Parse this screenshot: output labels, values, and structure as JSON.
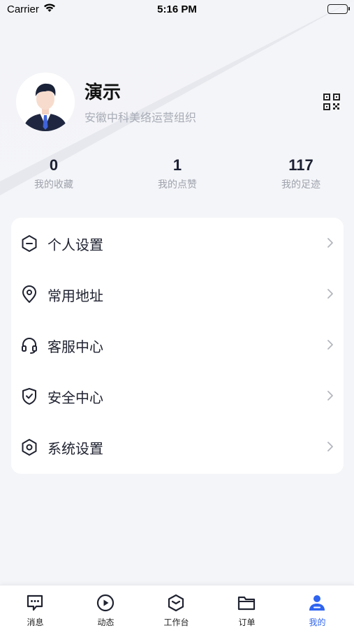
{
  "status_bar": {
    "carrier": "Carrier",
    "time": "5:16 PM"
  },
  "profile": {
    "name": "演示",
    "organization": "安徽中科美络运营组织"
  },
  "stats": [
    {
      "value": "0",
      "label": "我的收藏"
    },
    {
      "value": "1",
      "label": "我的点赞"
    },
    {
      "value": "117",
      "label": "我的足迹"
    }
  ],
  "menu": [
    {
      "label": "个人设置",
      "icon": "hexagon-minus-icon"
    },
    {
      "label": "常用地址",
      "icon": "location-pin-icon"
    },
    {
      "label": "客服中心",
      "icon": "headset-icon"
    },
    {
      "label": "安全中心",
      "icon": "shield-check-icon"
    },
    {
      "label": "系统设置",
      "icon": "hexagon-settings-icon"
    }
  ],
  "tabs": [
    {
      "label": "消息",
      "icon": "message-icon"
    },
    {
      "label": "动态",
      "icon": "play-circle-icon"
    },
    {
      "label": "工作台",
      "icon": "workbench-icon"
    },
    {
      "label": "订单",
      "icon": "folder-icon"
    },
    {
      "label": "我的",
      "icon": "user-icon",
      "active": true
    }
  ],
  "colors": {
    "accent": "#2f64f0",
    "background": "#f4f5f8",
    "text": "#1f2230",
    "muted": "#a8acb6"
  }
}
